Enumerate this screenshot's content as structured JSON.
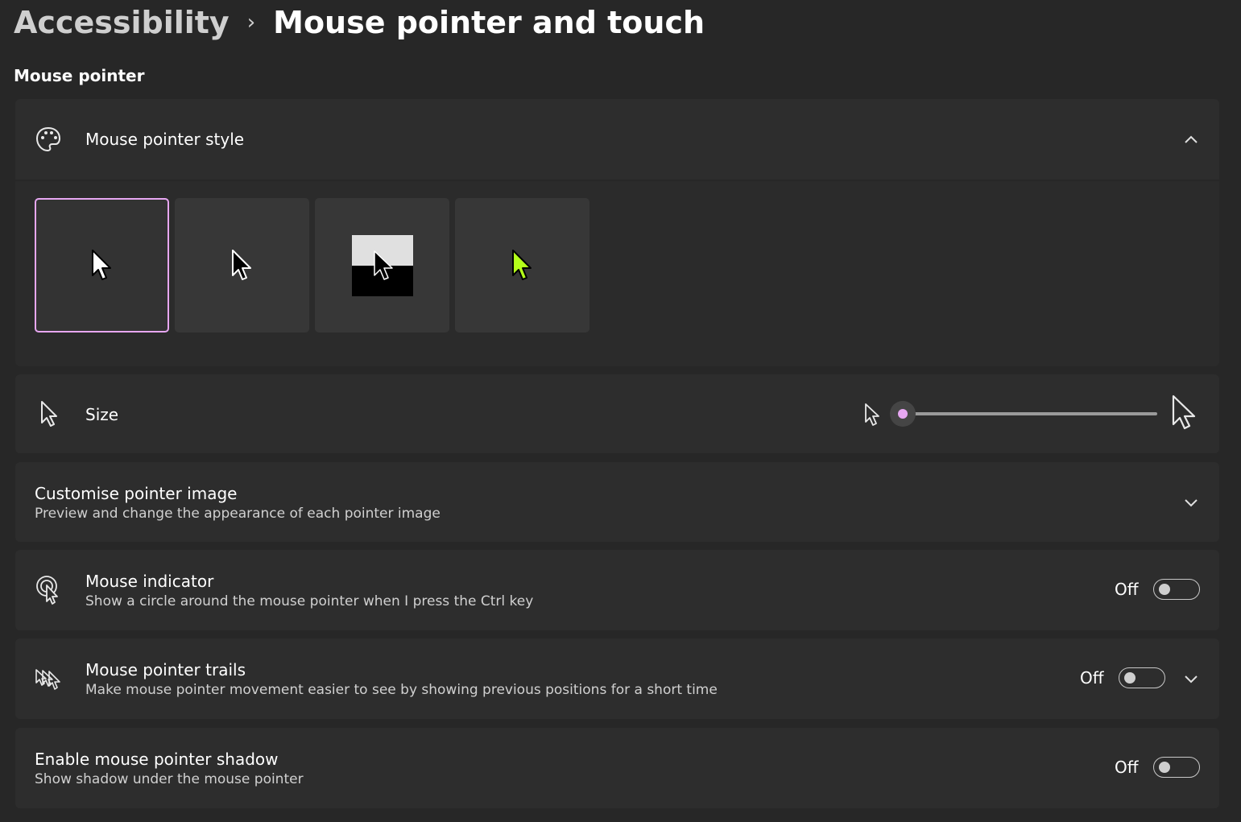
{
  "breadcrumb": {
    "parent": "Accessibility",
    "separator": "›",
    "current": "Mouse pointer and touch"
  },
  "section": {
    "title": "Mouse pointer"
  },
  "pointer_style": {
    "title": "Mouse pointer style",
    "icon": "palette-icon",
    "expanded": true,
    "options": [
      {
        "name": "white",
        "selected": true
      },
      {
        "name": "black",
        "selected": false
      },
      {
        "name": "inverted",
        "selected": false
      },
      {
        "name": "custom",
        "selected": false,
        "color": "#b4ff1a"
      }
    ]
  },
  "size": {
    "title": "Size",
    "icon": "cursor-icon",
    "slider_value": 0
  },
  "customise": {
    "title": "Customise pointer image",
    "subtitle": "Preview and change the appearance of each pointer image"
  },
  "mouse_indicator": {
    "title": "Mouse indicator",
    "subtitle": "Show a circle around the mouse pointer when I press the Ctrl key",
    "state": "Off",
    "icon": "mouse-indicator-icon"
  },
  "trails": {
    "title": "Mouse pointer trails",
    "subtitle": "Make mouse pointer movement easier to see by showing previous positions for a short time",
    "state": "Off",
    "icon": "pointer-trails-icon"
  },
  "shadow": {
    "title": "Enable mouse pointer shadow",
    "subtitle": "Show shadow under the mouse pointer",
    "state": "Off"
  },
  "colors": {
    "accent": "#e7a7f2",
    "background": "#272727",
    "card": "#2d2d2d",
    "custom_pointer": "#b4ff1a"
  }
}
